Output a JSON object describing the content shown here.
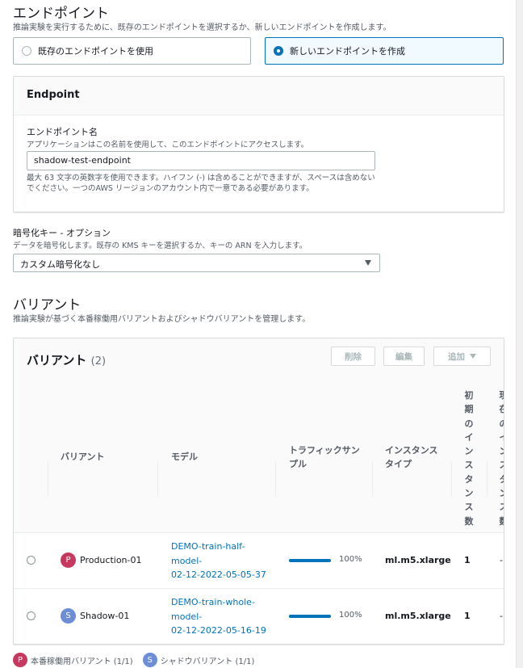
{
  "endpoint_section": {
    "title": "エンドポイント",
    "description": "推論実験を実行するために、既存のエンドポイントを選択するか、新しいエンドポイントを作成します。",
    "options": [
      {
        "label": "既存のエンドポイントを使用",
        "selected": false
      },
      {
        "label": "新しいエンドポイントを作成",
        "selected": true
      }
    ]
  },
  "endpoint_panel": {
    "header": "Endpoint",
    "name_label": "エンドポイント名",
    "name_description": "アプリケーションはこの名前を使用して、このエンドポイントにアクセスします。",
    "name_value": "shadow-test-endpoint",
    "constraint": "最大 63 文字の英数字を使用できます。ハイフン (-) は含めることができますが、スペースは含めないでください。一つのAWS リージョンのアカウント内で一意である必要があります。"
  },
  "encryption": {
    "label": "暗号化キー - オプション",
    "description": "データを暗号化します。既存の KMS キーを選択するか、キーの ARN を入力します。",
    "selected": "カスタム暗号化なし"
  },
  "variants_section": {
    "title": "バリアント",
    "description": "推論実験が基づく本番稼働用バリアントおよびシャドウバリアントを管理します。"
  },
  "variants_table": {
    "title": "バリアント",
    "count": "(2)",
    "buttons": {
      "delete": "削除",
      "edit": "編集",
      "add": "追加"
    },
    "columns": {
      "variant": "バリアント",
      "model": "モデル",
      "traffic": "トラフィックサンプル",
      "instance_type": "インスタンスタイプ",
      "initial_instances": "初期のインスタンス数",
      "current": "現在の インスタンス数"
    },
    "rows": [
      {
        "badge": "P",
        "name": "Production-01",
        "model": [
          "DEMO-train-half-",
          "model-",
          "02-12-2022-05-05-37"
        ],
        "traffic_pct": 100,
        "traffic_label": "100%",
        "instance_type": "ml.m5.xlarge",
        "initial": "1",
        "current": "-"
      },
      {
        "badge": "S",
        "name": "Shadow-01",
        "model": [
          "DEMO-train-whole-",
          "model-",
          "02-12-2022-05-16-19"
        ],
        "traffic_pct": 100,
        "traffic_label": "100%",
        "instance_type": "ml.m5.xlarge",
        "initial": "1",
        "current": "-"
      }
    ]
  },
  "legend": [
    {
      "badge": "P",
      "label": "本番稼働用バリアント (1/1)",
      "color": "#c7385e"
    },
    {
      "badge": "S",
      "label": "シャドウバリアント (1/1)",
      "color": "#6d8ed5"
    }
  ],
  "colors": {
    "accent": "#0073bb",
    "production": "#c7385e",
    "shadow": "#6d8ed5"
  }
}
